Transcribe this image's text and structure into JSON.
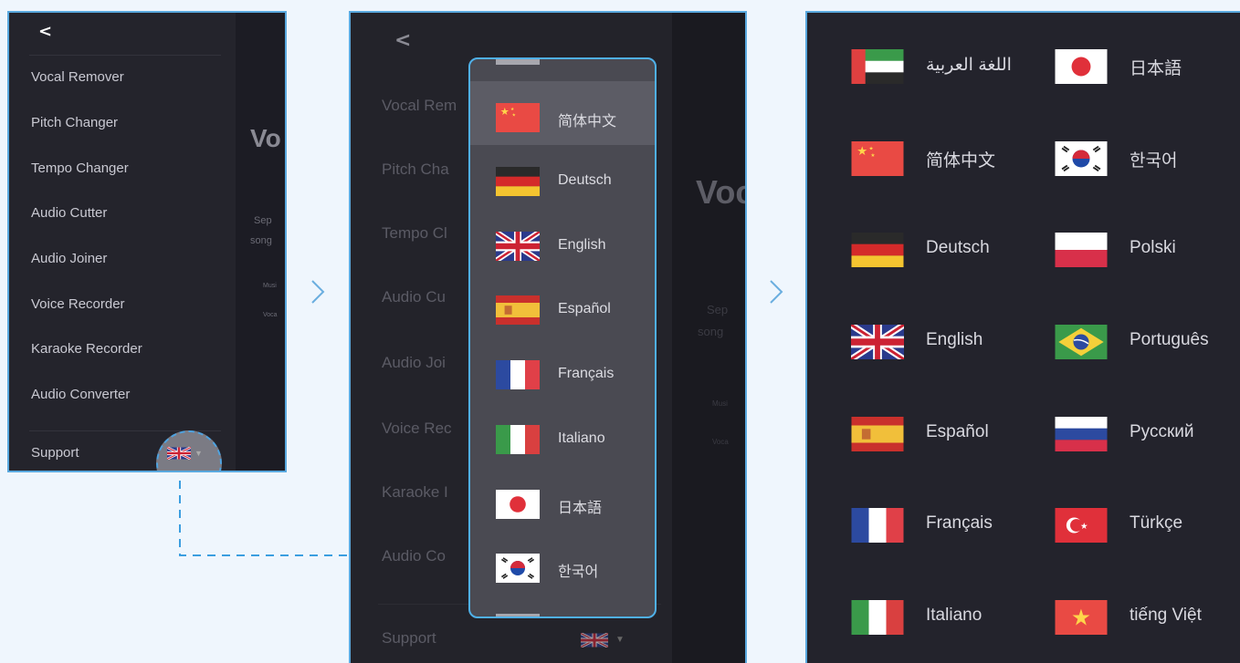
{
  "menu": {
    "back": "<",
    "items": [
      "Vocal Remover",
      "Pitch Changer",
      "Tempo Changer",
      "Audio Cutter",
      "Audio Joiner",
      "Voice Recorder",
      "Karaoke Recorder",
      "Audio Converter"
    ],
    "support": "Support",
    "current_language_flag": "uk-flag-icon"
  },
  "panel1_background": {
    "title_fragment": "Vo",
    "text_fragments": [
      "Sep",
      "song",
      "Musi",
      "Voca"
    ]
  },
  "panel2_background": {
    "items": [
      "Vocal Rem",
      "Pitch Cha",
      "Tempo Cl",
      "Audio Cu",
      "Audio Joi",
      "Voice Rec",
      "Karaoke I",
      "Audio Co"
    ],
    "support": "Support",
    "title_fragment": "Voc",
    "text_fragments": [
      "Sep",
      "song",
      "Musi",
      "Voca"
    ]
  },
  "dropdown": {
    "selected": "简体中文",
    "items": [
      {
        "label": "简体中文",
        "flag": "china-flag-icon"
      },
      {
        "label": "Deutsch",
        "flag": "germany-flag-icon"
      },
      {
        "label": "English",
        "flag": "uk-flag-icon"
      },
      {
        "label": "Español",
        "flag": "spain-flag-icon"
      },
      {
        "label": "Français",
        "flag": "france-flag-icon"
      },
      {
        "label": "Italiano",
        "flag": "italy-flag-icon"
      },
      {
        "label": "日本語",
        "flag": "japan-flag-icon"
      },
      {
        "label": "한국어",
        "flag": "korea-flag-icon"
      }
    ]
  },
  "languages": {
    "left": [
      {
        "label": "اللغة العربية",
        "flag": "uae-flag-icon"
      },
      {
        "label": "简体中文",
        "flag": "china-flag-icon"
      },
      {
        "label": "Deutsch",
        "flag": "germany-flag-icon"
      },
      {
        "label": "English",
        "flag": "uk-flag-icon"
      },
      {
        "label": "Español",
        "flag": "spain-flag-icon"
      },
      {
        "label": "Français",
        "flag": "france-flag-icon"
      },
      {
        "label": "Italiano",
        "flag": "italy-flag-icon"
      }
    ],
    "right": [
      {
        "label": "日本語",
        "flag": "japan-flag-icon"
      },
      {
        "label": "한국어",
        "flag": "korea-flag-icon"
      },
      {
        "label": "Polski",
        "flag": "poland-flag-icon"
      },
      {
        "label": "Português",
        "flag": "brazil-flag-icon"
      },
      {
        "label": "Русский",
        "flag": "russia-flag-icon"
      },
      {
        "label": "Türkçe",
        "flag": "turkey-flag-icon"
      },
      {
        "label": "tiếng Việt",
        "flag": "vietnam-flag-icon"
      }
    ]
  },
  "colors": {
    "accent": "#4fb0e8",
    "page_bg": "#eff6fd",
    "panel_dark": "#23232c"
  }
}
